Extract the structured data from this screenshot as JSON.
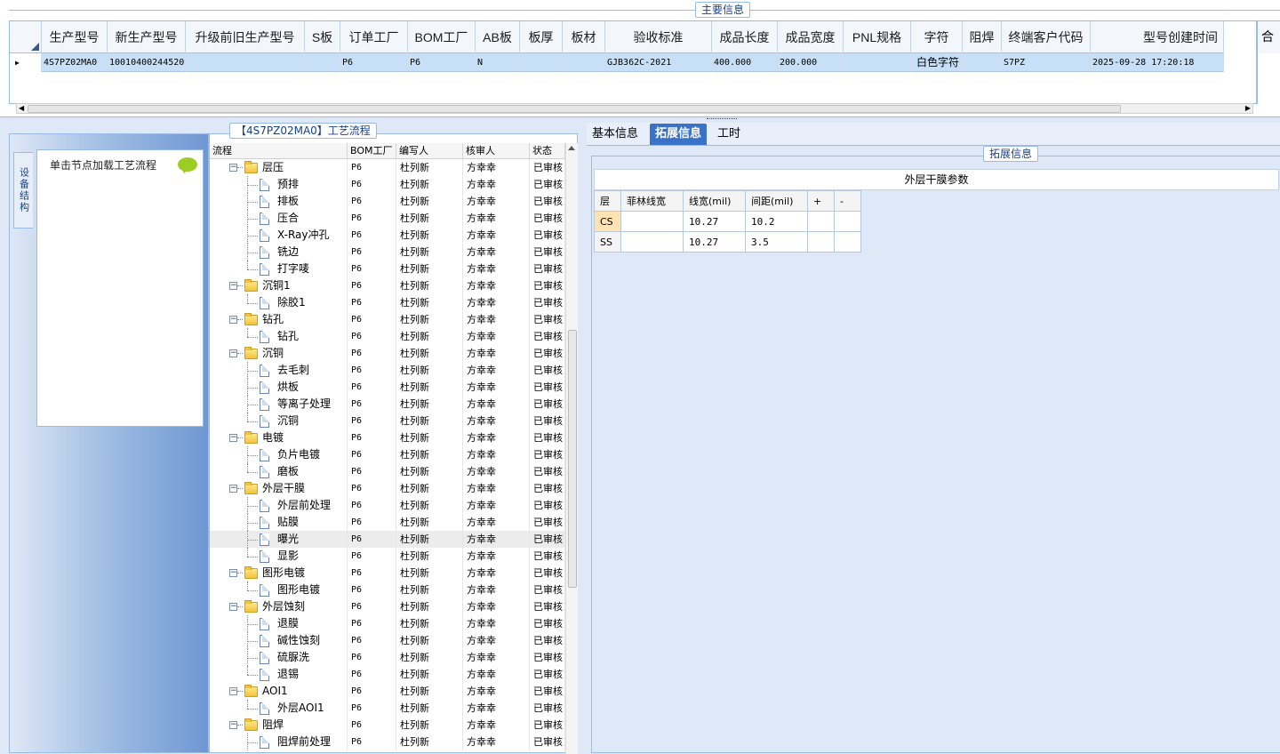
{
  "main_info": {
    "legend": "主要信息",
    "columns": [
      "生产型号",
      "新生产型号",
      "升级前旧生产型号",
      "S板",
      "订单工厂",
      "BOM工厂",
      "AB板",
      "板厚",
      "板材",
      "验收标准",
      "成品长度",
      "成品宽度",
      "PNL规格",
      "字符",
      "阻焊",
      "终端客户代码",
      "型号创建时间"
    ],
    "row": [
      "4S7PZ02MA0",
      "10010400244520",
      "",
      "",
      "P6",
      "P6",
      "N",
      "",
      "",
      "GJB362C-2021",
      "400.000",
      "200.000",
      "",
      "白色字符",
      "",
      "S7PZ",
      "2025-09-28 17:20:18"
    ],
    "extra_header": "合"
  },
  "left_panel": {
    "vertical_tab": "设备结构",
    "hint": "单击节点加载工艺流程"
  },
  "process": {
    "legend": "【4S7PZ02MA0】工艺流程",
    "headers": [
      "流程",
      "BOM工厂",
      "编写人",
      "核审人",
      "状态"
    ],
    "rows": [
      {
        "name": "层压",
        "level": 0,
        "bom": "P6",
        "writer": "杜列新",
        "reviewer": "方幸幸",
        "status": "已审核"
      },
      {
        "name": "预排",
        "level": 1,
        "bom": "P6",
        "writer": "杜列新",
        "reviewer": "方幸幸",
        "status": "已审核"
      },
      {
        "name": "排板",
        "level": 1,
        "bom": "P6",
        "writer": "杜列新",
        "reviewer": "方幸幸",
        "status": "已审核"
      },
      {
        "name": "压合",
        "level": 1,
        "bom": "P6",
        "writer": "杜列新",
        "reviewer": "方幸幸",
        "status": "已审核"
      },
      {
        "name": "X-Ray冲孔",
        "level": 1,
        "bom": "P6",
        "writer": "杜列新",
        "reviewer": "方幸幸",
        "status": "已审核"
      },
      {
        "name": "铣边",
        "level": 1,
        "bom": "P6",
        "writer": "杜列新",
        "reviewer": "方幸幸",
        "status": "已审核"
      },
      {
        "name": "打字唛",
        "level": 1,
        "last": true,
        "bom": "P6",
        "writer": "杜列新",
        "reviewer": "方幸幸",
        "status": "已审核"
      },
      {
        "name": "沉铜1",
        "level": 0,
        "bom": "P6",
        "writer": "杜列新",
        "reviewer": "方幸幸",
        "status": "已审核"
      },
      {
        "name": "除胶1",
        "level": 1,
        "last": true,
        "bom": "P6",
        "writer": "杜列新",
        "reviewer": "方幸幸",
        "status": "已审核"
      },
      {
        "name": "钻孔",
        "level": 0,
        "bom": "P6",
        "writer": "杜列新",
        "reviewer": "方幸幸",
        "status": "已审核"
      },
      {
        "name": "钻孔",
        "level": 1,
        "last": true,
        "bom": "P6",
        "writer": "杜列新",
        "reviewer": "方幸幸",
        "status": "已审核"
      },
      {
        "name": "沉铜",
        "level": 0,
        "bom": "P6",
        "writer": "杜列新",
        "reviewer": "方幸幸",
        "status": "已审核"
      },
      {
        "name": "去毛刺",
        "level": 1,
        "bom": "P6",
        "writer": "杜列新",
        "reviewer": "方幸幸",
        "status": "已审核"
      },
      {
        "name": "烘板",
        "level": 1,
        "bom": "P6",
        "writer": "杜列新",
        "reviewer": "方幸幸",
        "status": "已审核"
      },
      {
        "name": "等离子处理",
        "level": 1,
        "bom": "P6",
        "writer": "杜列新",
        "reviewer": "方幸幸",
        "status": "已审核"
      },
      {
        "name": "沉铜",
        "level": 1,
        "last": true,
        "bom": "P6",
        "writer": "杜列新",
        "reviewer": "方幸幸",
        "status": "已审核"
      },
      {
        "name": "电镀",
        "level": 0,
        "bom": "P6",
        "writer": "杜列新",
        "reviewer": "方幸幸",
        "status": "已审核"
      },
      {
        "name": "负片电镀",
        "level": 1,
        "bom": "P6",
        "writer": "杜列新",
        "reviewer": "方幸幸",
        "status": "已审核"
      },
      {
        "name": "磨板",
        "level": 1,
        "last": true,
        "bom": "P6",
        "writer": "杜列新",
        "reviewer": "方幸幸",
        "status": "已审核"
      },
      {
        "name": "外层干膜",
        "level": 0,
        "bom": "P6",
        "writer": "杜列新",
        "reviewer": "方幸幸",
        "status": "已审核"
      },
      {
        "name": "外层前处理",
        "level": 1,
        "bom": "P6",
        "writer": "杜列新",
        "reviewer": "方幸幸",
        "status": "已审核"
      },
      {
        "name": "贴膜",
        "level": 1,
        "bom": "P6",
        "writer": "杜列新",
        "reviewer": "方幸幸",
        "status": "已审核"
      },
      {
        "name": "曝光",
        "level": 1,
        "selected": true,
        "bom": "P6",
        "writer": "杜列新",
        "reviewer": "方幸幸",
        "status": "已审核"
      },
      {
        "name": "显影",
        "level": 1,
        "last": true,
        "bom": "P6",
        "writer": "杜列新",
        "reviewer": "方幸幸",
        "status": "已审核"
      },
      {
        "name": "图形电镀",
        "level": 0,
        "bom": "P6",
        "writer": "杜列新",
        "reviewer": "方幸幸",
        "status": "已审核"
      },
      {
        "name": "图形电镀",
        "level": 1,
        "last": true,
        "bom": "P6",
        "writer": "杜列新",
        "reviewer": "方幸幸",
        "status": "已审核"
      },
      {
        "name": "外层蚀刻",
        "level": 0,
        "bom": "P6",
        "writer": "杜列新",
        "reviewer": "方幸幸",
        "status": "已审核"
      },
      {
        "name": "退膜",
        "level": 1,
        "bom": "P6",
        "writer": "杜列新",
        "reviewer": "方幸幸",
        "status": "已审核"
      },
      {
        "name": "碱性蚀刻",
        "level": 1,
        "bom": "P6",
        "writer": "杜列新",
        "reviewer": "方幸幸",
        "status": "已审核"
      },
      {
        "name": "硫脲洗",
        "level": 1,
        "bom": "P6",
        "writer": "杜列新",
        "reviewer": "方幸幸",
        "status": "已审核"
      },
      {
        "name": "退锡",
        "level": 1,
        "last": true,
        "bom": "P6",
        "writer": "杜列新",
        "reviewer": "方幸幸",
        "status": "已审核"
      },
      {
        "name": "AOI1",
        "level": 0,
        "bom": "P6",
        "writer": "杜列新",
        "reviewer": "方幸幸",
        "status": "已审核"
      },
      {
        "name": "外层AOI1",
        "level": 1,
        "last": true,
        "bom": "P6",
        "writer": "杜列新",
        "reviewer": "方幸幸",
        "status": "已审核"
      },
      {
        "name": "阻焊",
        "level": 0,
        "bom": "P6",
        "writer": "杜列新",
        "reviewer": "方幸幸",
        "status": "已审核"
      },
      {
        "name": "阻焊前处理",
        "level": 1,
        "bom": "P6",
        "writer": "杜列新",
        "reviewer": "方幸幸",
        "status": "已审核"
      }
    ]
  },
  "tabs": [
    "基本信息",
    "拓展信息",
    "工时"
  ],
  "active_tab": "拓展信息",
  "extension": {
    "legend": "拓展信息",
    "title": "外层干膜参数",
    "headers": [
      "层",
      "菲林线宽",
      "线宽(mil)",
      "间距(mil)",
      "+",
      "-"
    ],
    "rows": [
      [
        "CS",
        "",
        "10.27",
        "10.2",
        "",
        ""
      ],
      [
        "SS",
        "",
        "10.27",
        "3.5",
        "",
        ""
      ]
    ]
  },
  "colors": {
    "accent": "#3a72c8",
    "border": "#99bbe8",
    "selected_row": "#c7e0f7"
  }
}
